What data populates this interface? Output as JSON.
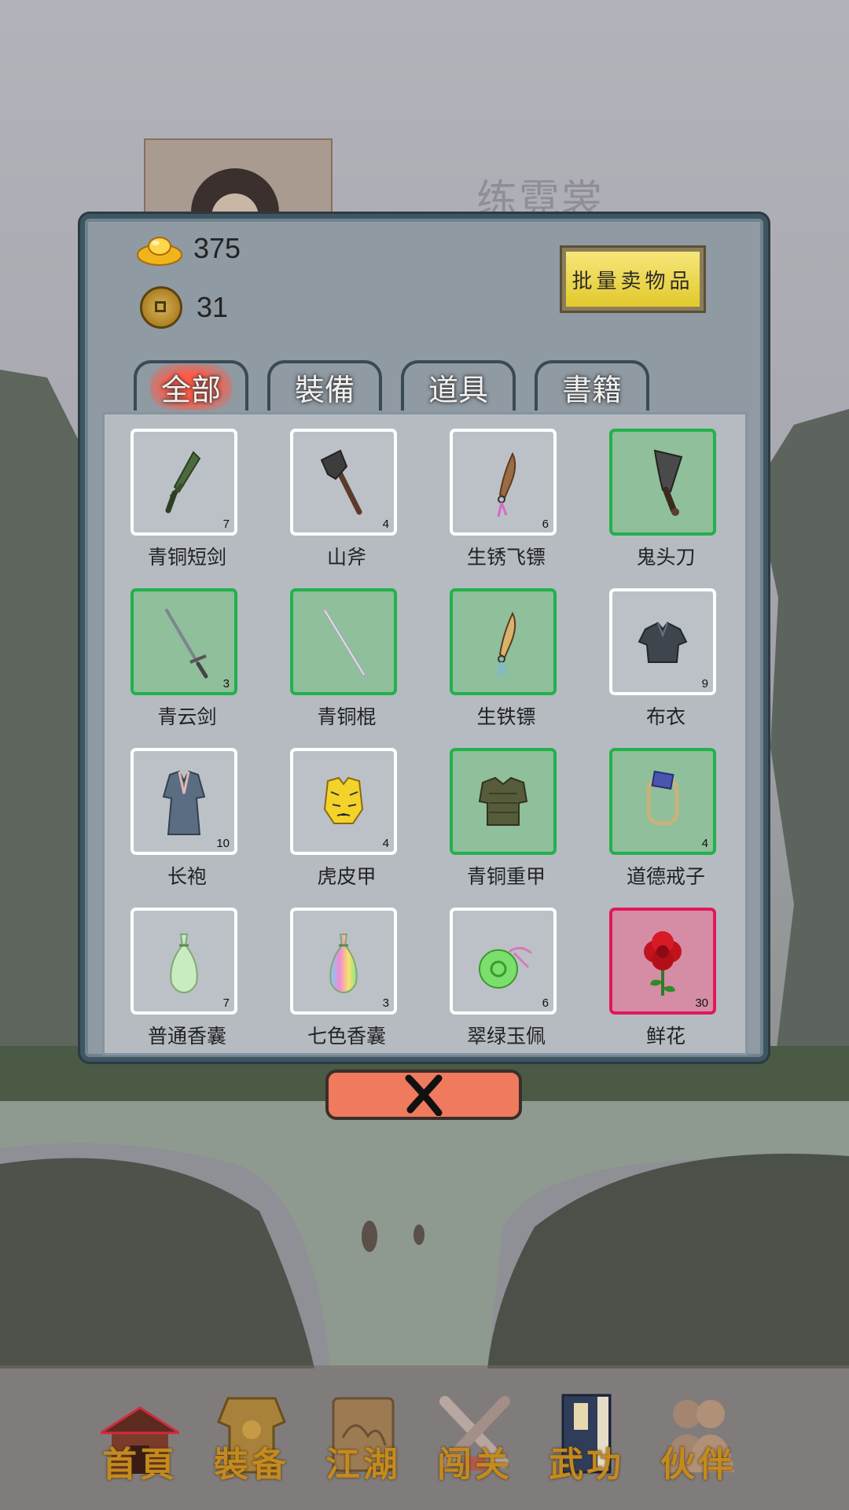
{
  "background": {
    "character_name": "练霓裳"
  },
  "currency": {
    "gold_ingot": {
      "icon": "gold-ingot-icon",
      "value": "375"
    },
    "copper_coin": {
      "icon": "copper-coin-icon",
      "value": "31"
    }
  },
  "bulk_sell_label": "批量卖物品",
  "tabs": [
    {
      "label": "全部",
      "active": true
    },
    {
      "label": "裝備",
      "active": false
    },
    {
      "label": "道具",
      "active": false
    },
    {
      "label": "書籍",
      "active": false
    }
  ],
  "items": [
    {
      "name": "青铜短剑",
      "count": "7",
      "rarity": "white",
      "icon": "short-sword-icon"
    },
    {
      "name": "山斧",
      "count": "4",
      "rarity": "white",
      "icon": "axe-icon"
    },
    {
      "name": "生锈飞镖",
      "count": "6",
      "rarity": "white",
      "icon": "dart-icon"
    },
    {
      "name": "鬼头刀",
      "count": "",
      "rarity": "green",
      "icon": "broadsword-icon"
    },
    {
      "name": "青云剑",
      "count": "3",
      "rarity": "green",
      "icon": "long-sword-icon"
    },
    {
      "name": "青铜棍",
      "count": "",
      "rarity": "green",
      "icon": "staff-icon"
    },
    {
      "name": "生铁镖",
      "count": "",
      "rarity": "green",
      "icon": "dart-icon"
    },
    {
      "name": "布衣",
      "count": "9",
      "rarity": "white",
      "icon": "cloth-shirt-icon"
    },
    {
      "name": "长袍",
      "count": "10",
      "rarity": "white",
      "icon": "robe-icon"
    },
    {
      "name": "虎皮甲",
      "count": "4",
      "rarity": "white",
      "icon": "tiger-armor-icon"
    },
    {
      "name": "青铜重甲",
      "count": "",
      "rarity": "green",
      "icon": "heavy-armor-icon"
    },
    {
      "name": "道德戒子",
      "count": "4",
      "rarity": "green",
      "icon": "ring-icon"
    },
    {
      "name": "普通香囊",
      "count": "7",
      "rarity": "white",
      "icon": "sachet-icon"
    },
    {
      "name": "七色香囊",
      "count": "3",
      "rarity": "white",
      "icon": "sachet-icon"
    },
    {
      "name": "翠绿玉佩",
      "count": "6",
      "rarity": "white",
      "icon": "jade-pendant-icon"
    },
    {
      "name": "鲜花",
      "count": "30",
      "rarity": "red",
      "icon": "flower-icon"
    }
  ],
  "close_icon": "close-icon",
  "nav": [
    {
      "label": "首頁",
      "icon": "house-icon"
    },
    {
      "label": "裝备",
      "icon": "armor-icon"
    },
    {
      "label": "江湖",
      "icon": "scroll-map-icon"
    },
    {
      "label": "闯关",
      "icon": "crossed-swords-icon"
    },
    {
      "label": "武功",
      "icon": "book-icon"
    },
    {
      "label": "伙伴",
      "icon": "partners-icon"
    }
  ],
  "colors": {
    "rarity_white": "#ffffff",
    "rarity_green": "#22b14c",
    "rarity_red": "#e0185a",
    "active_tab": "#ff5b47",
    "close_button": "#ef7a5d",
    "bulk_sell": "#f0d94a",
    "nav_label": "#c48a1c"
  }
}
